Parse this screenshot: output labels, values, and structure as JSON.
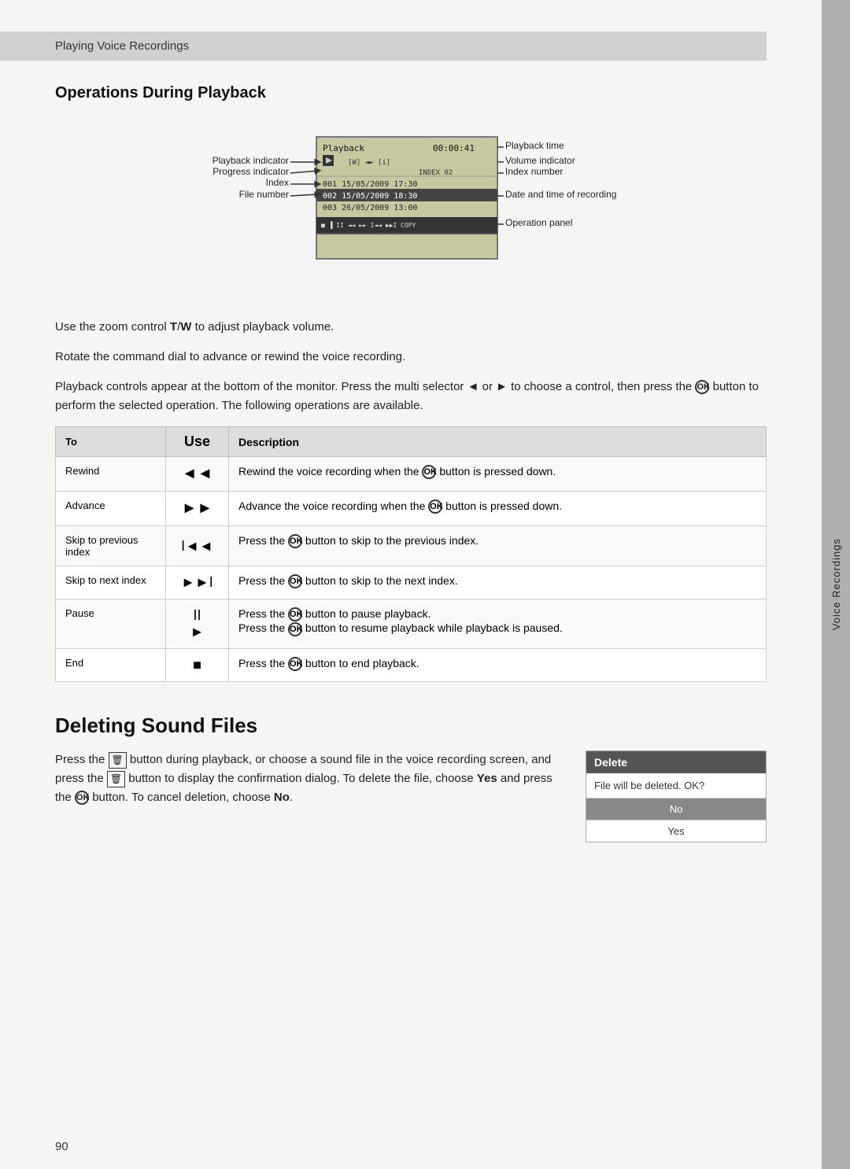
{
  "header": {
    "section": "Playing Voice Recordings"
  },
  "operations_title": "Operations During Playback",
  "diagram": {
    "labels": {
      "playback_indicator": "Playback indicator",
      "progress_indicator": "Progress indicator",
      "index": "Index",
      "file_number": "File number",
      "playback_time": "Playback time",
      "volume_indicator": "Volume indicator",
      "index_number": "Index number",
      "date_time_recording": "Date and time of recording",
      "operation_panel": "Operation panel"
    },
    "lcd": {
      "title": "Playback",
      "time": "00:00:41",
      "files": [
        {
          "num": "001",
          "date": "15/05/2009",
          "time": "17:30",
          "selected": false
        },
        {
          "num": "002",
          "date": "15/05/2009",
          "time": "18:30",
          "selected": true
        },
        {
          "num": "003",
          "date": "26/05/2009",
          "time": "13:00",
          "selected": false
        }
      ],
      "index": "INDEX 02",
      "panel_text": "■ ▐ II ◄◄ ►► I◄◄ ►►I     COPY"
    }
  },
  "body_paragraphs": [
    "Use the zoom control T/W to adjust playback volume.",
    "Rotate the command dial to advance or rewind the voice recording.",
    "Playback controls appear at the bottom of the monitor. Press the multi selector ◄ or ► to choose a control, then press the  button to perform the selected operation. The following operations are available."
  ],
  "table": {
    "headers": [
      "To",
      "Use",
      "Description"
    ],
    "rows": [
      {
        "to": "Rewind",
        "use": "◄◄",
        "description": "Rewind the voice recording when the  button is pressed down."
      },
      {
        "to": "Advance",
        "use": "►►",
        "description": "Advance the voice recording when the  button is pressed down."
      },
      {
        "to": "Skip to previous index",
        "use": "I◄◄",
        "description": "Press the  button to skip to the previous index."
      },
      {
        "to": "Skip to next index",
        "use": "►►I",
        "description": "Press the  button to skip to the next index."
      },
      {
        "to": "Pause",
        "use": "II\n►",
        "description": "Press the  button to pause playback.\nPress the  button to resume playback while playback is paused."
      },
      {
        "to": "End",
        "use": "■",
        "description": "Press the  button to end playback."
      }
    ]
  },
  "deleting_title": "Deleting Sound Files",
  "deleting_body": "Press the  button during playback, or choose a sound file in the voice recording screen, and press the  button to display the confirmation dialog. To delete the file, choose Yes and press the  button. To cancel deletion, choose No.",
  "delete_dialog": {
    "title": "Delete",
    "message": "File will be deleted. OK?",
    "no": "No",
    "yes": "Yes"
  },
  "side_tab": "Voice Recordings",
  "page_number": "90"
}
